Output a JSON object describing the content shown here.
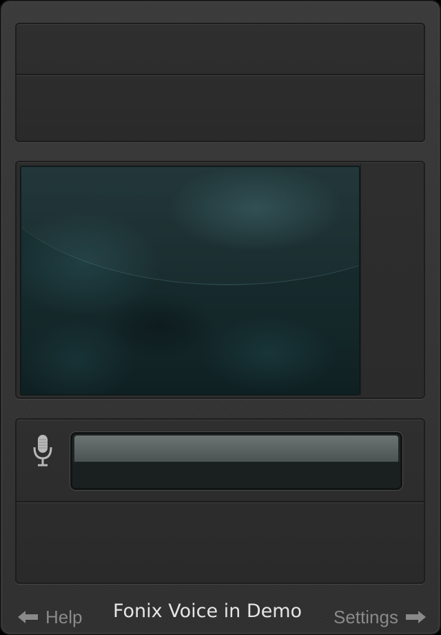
{
  "app": {
    "title": "Fonix Voice in Demo"
  },
  "footer": {
    "help_label": "Help",
    "settings_label": "Settings",
    "help_icon": "arrow-left-icon",
    "settings_icon": "arrow-right-icon"
  },
  "input": {
    "mic_icon": "microphone-icon",
    "value": ""
  },
  "colors": {
    "screen_tint": "#1a3033",
    "panel_bg": "#2c2c2c",
    "footer_text": "#8a8a8a",
    "title_text": "#e6e6e6"
  }
}
